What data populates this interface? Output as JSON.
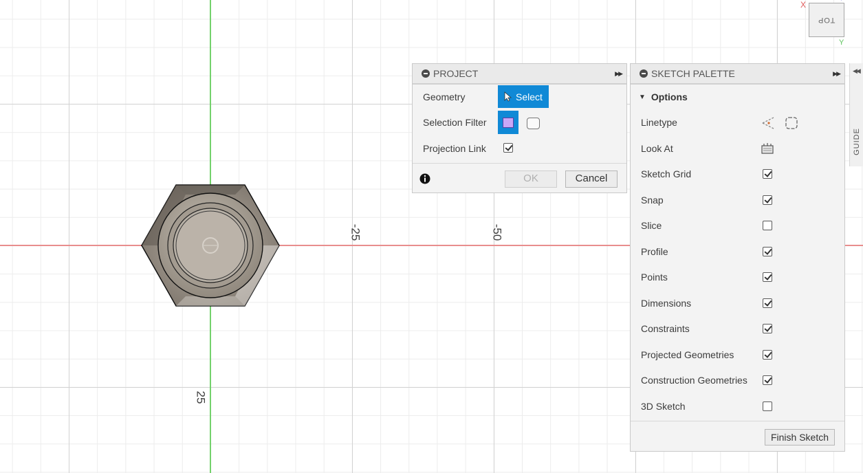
{
  "viewport": {
    "dimensions": [
      "-25",
      "-50",
      "25"
    ],
    "viewcube": {
      "face": "TOP",
      "x_axis": "X",
      "y_axis": "Y"
    }
  },
  "project_panel": {
    "title": "PROJECT",
    "geometry_label": "Geometry",
    "select_label": "Select",
    "selection_filter_label": "Selection Filter",
    "projection_link_label": "Projection Link",
    "projection_link_checked": true,
    "ok_label": "OK",
    "cancel_label": "Cancel"
  },
  "sketch_palette": {
    "title": "SKETCH PALETTE",
    "section": "Options",
    "linetype_label": "Linetype",
    "look_at_label": "Look At",
    "options": [
      {
        "label": "Sketch Grid",
        "checked": true
      },
      {
        "label": "Snap",
        "checked": true
      },
      {
        "label": "Slice",
        "checked": false
      },
      {
        "label": "Profile",
        "checked": true
      },
      {
        "label": "Points",
        "checked": true
      },
      {
        "label": "Dimensions",
        "checked": true
      },
      {
        "label": "Constraints",
        "checked": true
      },
      {
        "label": "Projected Geometries",
        "checked": true
      },
      {
        "label": "Construction Geometries",
        "checked": true
      },
      {
        "label": "3D Sketch",
        "checked": false
      }
    ],
    "finish_label": "Finish Sketch"
  },
  "guide_tab": {
    "label": "GUIDE"
  }
}
